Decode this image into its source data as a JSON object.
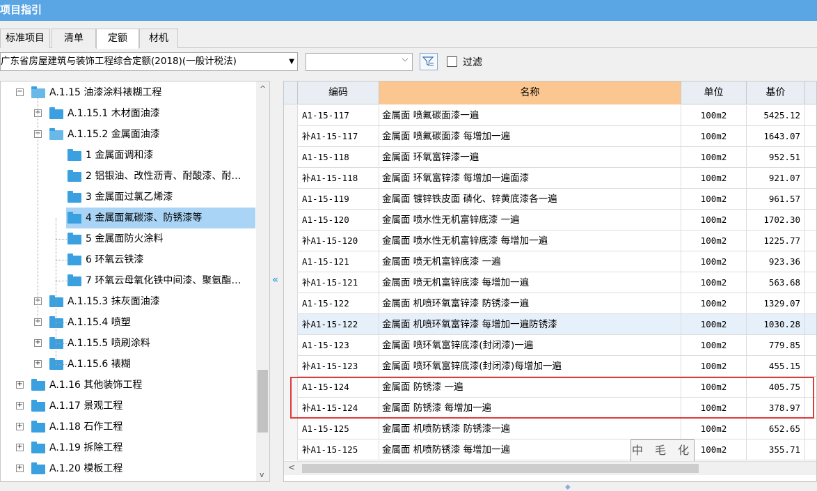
{
  "window": {
    "title": "项目指引"
  },
  "tabs": [
    {
      "label": "标准项目",
      "active": false
    },
    {
      "label": "清单",
      "active": false
    },
    {
      "label": "定额",
      "active": true
    },
    {
      "label": "材机",
      "active": false
    }
  ],
  "toolbar": {
    "quota_library": "广东省房屋建筑与装饰工程综合定额(2018)(一般计税法)",
    "search_value": "",
    "filter_label": "过滤",
    "filter_checked": false
  },
  "tree": [
    {
      "label": "A.1.15 油漆涂料裱糊工程",
      "toggle": "−"
    },
    {
      "label": "A.1.15.1 木材面油漆",
      "toggle": "+"
    },
    {
      "label": "A.1.15.2 金属面油漆",
      "toggle": "−"
    },
    {
      "label": "1 金属面调和漆",
      "toggle": ""
    },
    {
      "label": "2 铝银油、改性沥青、耐酸漆、耐…",
      "toggle": ""
    },
    {
      "label": "3 金属面过氯乙烯漆",
      "toggle": ""
    },
    {
      "label": "4 金属面氟碳漆、防锈漆等",
      "toggle": "",
      "selected": true
    },
    {
      "label": "5 金属面防火涂料",
      "toggle": ""
    },
    {
      "label": "6 环氧云铁漆",
      "toggle": ""
    },
    {
      "label": "7 环氧云母氧化铁中间漆、聚氨酯…",
      "toggle": ""
    },
    {
      "label": "A.1.15.3 抹灰面油漆",
      "toggle": "+"
    },
    {
      "label": "A.1.15.4 喷塑",
      "toggle": "+"
    },
    {
      "label": "A.1.15.5 喷刷涂料",
      "toggle": "+"
    },
    {
      "label": "A.1.15.6 裱糊",
      "toggle": "+"
    },
    {
      "label": "A.1.16 其他装饰工程",
      "toggle": "+"
    },
    {
      "label": "A.1.17 景观工程",
      "toggle": "+"
    },
    {
      "label": "A.1.18 石作工程",
      "toggle": "+"
    },
    {
      "label": "A.1.19 拆除工程",
      "toggle": "+"
    },
    {
      "label": "A.1.20 模板工程",
      "toggle": "+"
    }
  ],
  "grid": {
    "headers": {
      "code": "编码",
      "name": "名称",
      "unit": "单位",
      "price": "基价"
    },
    "rows": [
      {
        "code": "A1-15-117",
        "name": "金属面 喷氟碳面漆一遍",
        "unit": "100m2",
        "price": "5425.12"
      },
      {
        "code": "补A1-15-117",
        "name": "金属面 喷氟碳面漆 每增加一遍",
        "unit": "100m2",
        "price": "1643.07"
      },
      {
        "code": "A1-15-118",
        "name": "金属面 环氧富锌漆一遍",
        "unit": "100m2",
        "price": "952.51"
      },
      {
        "code": "补A1-15-118",
        "name": "金属面 环氧富锌漆 每增加一遍面漆",
        "unit": "100m2",
        "price": "921.07"
      },
      {
        "code": "A1-15-119",
        "name": "金属面 镀锌铁皮面 磷化、锌黄底漆各一遍",
        "unit": "100m2",
        "price": "961.57"
      },
      {
        "code": "A1-15-120",
        "name": "金属面 喷水性无机富锌底漆 一遍",
        "unit": "100m2",
        "price": "1702.30"
      },
      {
        "code": "补A1-15-120",
        "name": "金属面 喷水性无机富锌底漆 每增加一遍",
        "unit": "100m2",
        "price": "1225.77"
      },
      {
        "code": "A1-15-121",
        "name": "金属面 喷无机富锌底漆 一遍",
        "unit": "100m2",
        "price": "923.36"
      },
      {
        "code": "补A1-15-121",
        "name": "金属面 喷无机富锌底漆 每增加一遍",
        "unit": "100m2",
        "price": "563.68"
      },
      {
        "code": "A1-15-122",
        "name": "金属面 机喷环氧富锌漆 防锈漆一遍",
        "unit": "100m2",
        "price": "1329.07"
      },
      {
        "code": "补A1-15-122",
        "name": "金属面 机喷环氧富锌漆 每增加一遍防锈漆",
        "unit": "100m2",
        "price": "1030.28",
        "alt": true
      },
      {
        "code": "A1-15-123",
        "name": "金属面 喷环氧富锌底漆(封闭漆)一遍",
        "unit": "100m2",
        "price": "779.85"
      },
      {
        "code": "补A1-15-123",
        "name": "金属面 喷环氧富锌底漆(封闭漆)每增加一遍",
        "unit": "100m2",
        "price": "455.15"
      },
      {
        "code": "A1-15-124",
        "name": "金属面 防锈漆 一遍",
        "unit": "100m2",
        "price": "405.75"
      },
      {
        "code": "补A1-15-124",
        "name": "金属面 防锈漆 每增加一遍",
        "unit": "100m2",
        "price": "378.97"
      },
      {
        "code": "A1-15-125",
        "name": "金属面 机喷防锈漆 防锈漆一遍",
        "unit": "100m2",
        "price": "652.65"
      },
      {
        "code": "补A1-15-125",
        "name": "金属面 机喷防锈漆 每增加一遍",
        "unit": "100m2",
        "price": "355.71"
      }
    ]
  },
  "watermark": "中 毛 化",
  "colors": {
    "title_bar": "#5aa5e4",
    "name_header": "#fbc68f",
    "selected_tree": "#a9d4f5",
    "highlight": "#e23a3a",
    "folder": "#3aa0df"
  }
}
